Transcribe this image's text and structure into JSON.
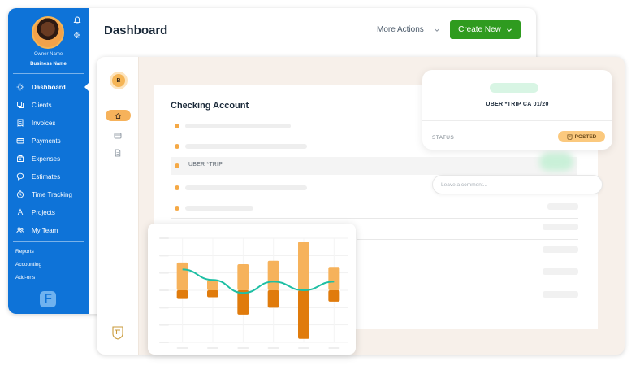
{
  "dashboard": {
    "title": "Dashboard",
    "more_actions": "More Actions",
    "create_new": "Create New",
    "owner_name": "Owner Name",
    "business_name": "Business Name",
    "nav": [
      {
        "label": "Dashboard",
        "icon": "dashboard-icon",
        "active": true
      },
      {
        "label": "Clients",
        "icon": "clients-icon"
      },
      {
        "label": "Invoices",
        "icon": "invoices-icon"
      },
      {
        "label": "Payments",
        "icon": "payments-icon"
      },
      {
        "label": "Expenses",
        "icon": "expenses-icon"
      },
      {
        "label": "Estimates",
        "icon": "estimates-icon"
      },
      {
        "label": "Time Tracking",
        "icon": "clock-icon"
      },
      {
        "label": "Projects",
        "icon": "projects-icon"
      },
      {
        "label": "My Team",
        "icon": "team-icon"
      }
    ],
    "sub_nav": [
      "Reports",
      "Accounting",
      "Add-ons"
    ],
    "logo_letter": "F",
    "colors": {
      "sidebar": "#0e73d8",
      "create_button": "#2f9b1f"
    }
  },
  "accounting": {
    "avatar_letter": "B",
    "checking_title": "Checking Account",
    "highlight_row": "UBER *TRIP",
    "detail_title": "UBER *TRIP CA 01/20",
    "status_label": "STATUS",
    "status_value": "POSTED",
    "comment_placeholder": "Leave a comment...",
    "colors": {
      "accent": "#f6b25b",
      "posted": "#fbc97e"
    }
  },
  "chart_data": {
    "type": "bar",
    "description": "Stacked floating bars (income above, expenses below baseline) with a smooth trend line; no axis labels shown",
    "categories": [
      "",
      "",
      "",
      "",
      "",
      ""
    ],
    "series": [
      {
        "name": "",
        "values": [
          32,
          12,
          30,
          34,
          56,
          27
        ],
        "color": "#f6b25b"
      },
      {
        "name": "",
        "values": [
          -10,
          -8,
          -28,
          -20,
          -56,
          -13
        ],
        "color": "#e07b0c"
      }
    ],
    "trend": [
      24,
      12,
      -3,
      10,
      0,
      10
    ],
    "ylim": [
      -60,
      60
    ]
  }
}
